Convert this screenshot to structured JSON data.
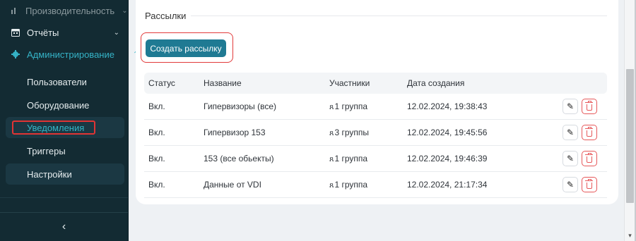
{
  "sidebar": {
    "items": [
      {
        "label": "Производительность",
        "icon": "bar-chart-icon"
      },
      {
        "label": "Отчёты",
        "icon": "calendar-icon"
      },
      {
        "label": "Администрирование",
        "icon": "gear-icon"
      }
    ],
    "subitems": [
      {
        "label": "Пользователи"
      },
      {
        "label": "Оборудование"
      },
      {
        "label": "Уведомления"
      },
      {
        "label": "Триггеры"
      },
      {
        "label": "Настройки"
      }
    ],
    "collapse_icon": "‹"
  },
  "main": {
    "section_title": "Рассылки",
    "create_button": "Создать рассылку",
    "columns": [
      "Статус",
      "Название",
      "Участники",
      "Дата создания"
    ],
    "rows": [
      {
        "status": "Вкл.",
        "name": "Гипервизоры (все)",
        "participants": "1 группа",
        "created": "12.02.2024, 19:38:43"
      },
      {
        "status": "Вкл.",
        "name": "Гипервизор 153",
        "participants": "3 группы",
        "created": "12.02.2024, 19:45:56"
      },
      {
        "status": "Вкл.",
        "name": "153 (все обьекты)",
        "participants": "1 группа",
        "created": "12.02.2024, 19:46:39"
      },
      {
        "status": "Вкл.",
        "name": "Данные от VDI",
        "participants": "1 группа",
        "created": "12.02.2024, 21:17:34"
      }
    ]
  },
  "colors": {
    "sidebar_bg": "#132b33",
    "accent": "#1f7a93",
    "active_text": "#35b3c7",
    "danger": "#e6585a",
    "highlight_outline": "#e13434"
  }
}
